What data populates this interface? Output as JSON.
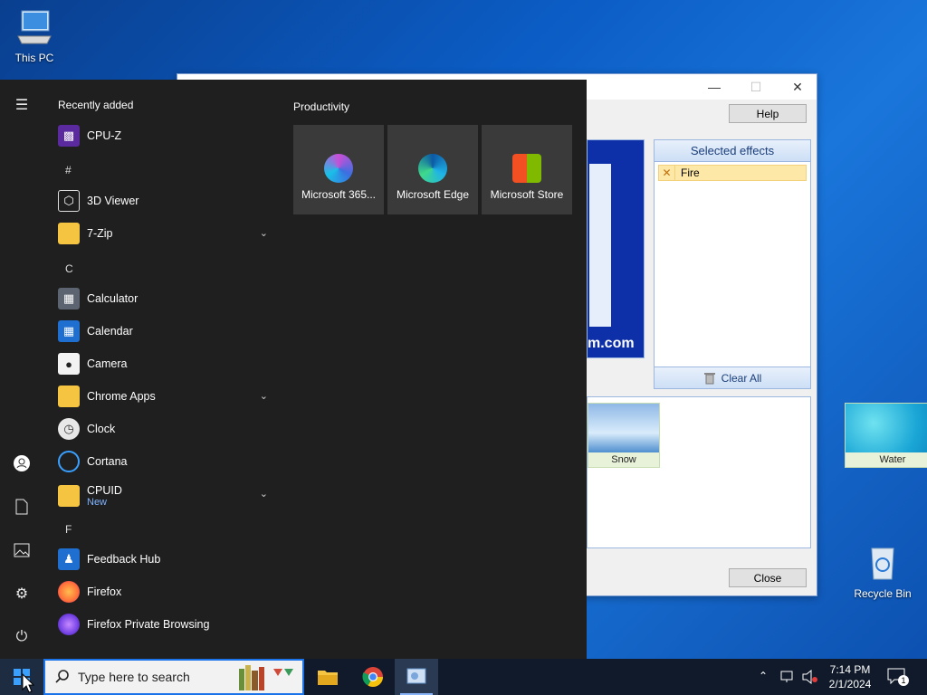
{
  "desktop": {
    "this_pc": "This PC",
    "recycle_bin": "Recycle Bin"
  },
  "dialog": {
    "help": "Help",
    "close_button": "Close",
    "selected_effects_title": "Selected effects",
    "selected_effects": [
      "Fire"
    ],
    "clear_all": "Clear All",
    "preview_watermark": "m.com",
    "gallery": [
      {
        "label": "Snow"
      },
      {
        "label": "Water"
      }
    ]
  },
  "start_menu": {
    "recently_added_title": "Recently added",
    "productivity_title": "Productivity",
    "apps": {
      "cpuz": "CPU-Z",
      "hash": "#",
      "viewer3d": "3D Viewer",
      "zip7": "7-Zip",
      "letter_c": "C",
      "calculator": "Calculator",
      "calendar": "Calendar",
      "camera": "Camera",
      "chrome_apps": "Chrome Apps",
      "clock": "Clock",
      "cortana": "Cortana",
      "cpuid": "CPUID",
      "cpuid_badge": "New",
      "letter_f": "F",
      "feedback_hub": "Feedback Hub",
      "firefox": "Firefox",
      "firefox_private": "Firefox Private Browsing"
    },
    "tiles": [
      {
        "label": "Microsoft 365..."
      },
      {
        "label": "Microsoft Edge"
      },
      {
        "label": "Microsoft Store"
      }
    ]
  },
  "taskbar": {
    "search_placeholder": "Type here to search",
    "time": "7:14 PM",
    "date": "2/1/2024",
    "notification_count": "1"
  },
  "colors": {
    "accent": "#1a73e8",
    "start_bg": "#1f1f1f",
    "tile_bg": "#3a3a3a"
  }
}
